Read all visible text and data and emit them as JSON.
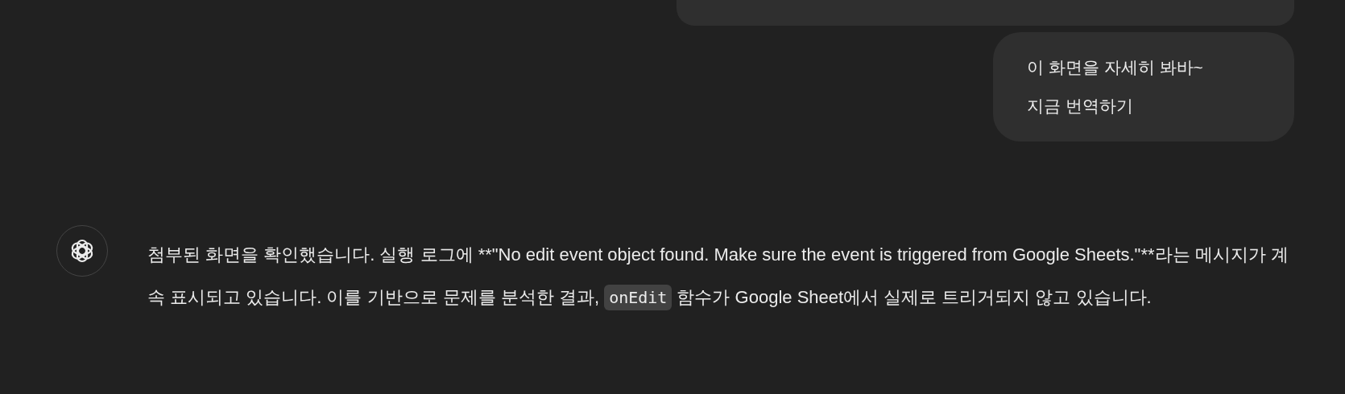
{
  "previous_message": {
    "kind": "bubble"
  },
  "user_message": {
    "lines": [
      "이 화면을 자세히 봐바~",
      "지금 번역하기"
    ]
  },
  "assistant_message": {
    "segments": [
      {
        "kind": "text",
        "text": "첨부된 화면을 확인했습니다. 실행 로그에 **\"No edit event object found. Make sure the event is triggered from Google Sheets.\"**라는 메시지가 계속 표시되고 있습니다. 이를 기반으로 문제를 분석한 결과, "
      },
      {
        "kind": "code",
        "text": "onEdit"
      },
      {
        "kind": "text",
        "text": " 함수가 Google Sheet에서 실제로 트리거되지 않고 있습니다."
      }
    ]
  }
}
